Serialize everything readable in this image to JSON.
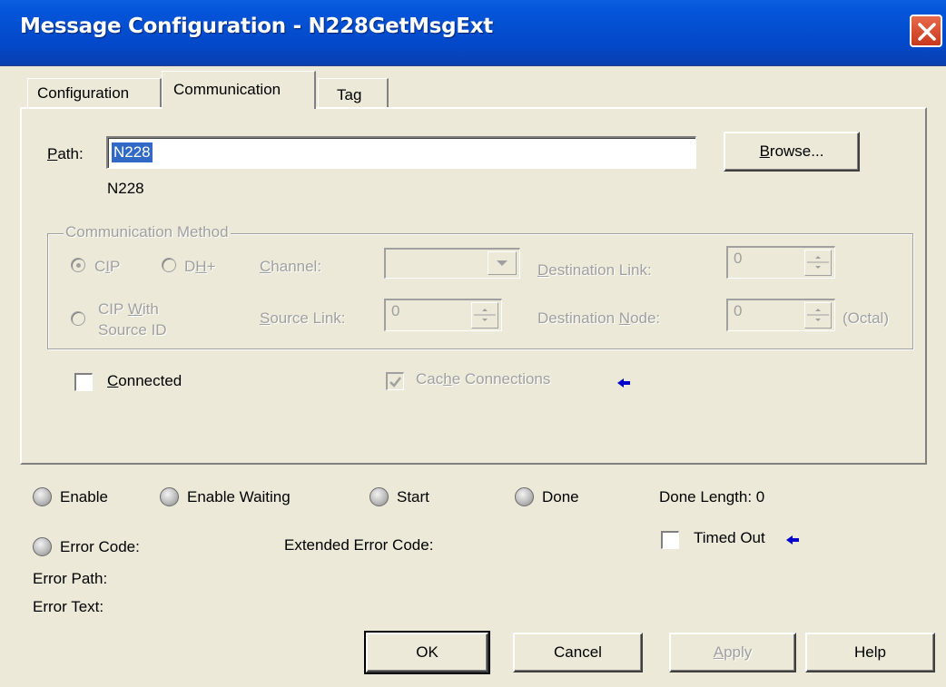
{
  "window": {
    "title": "Message Configuration - N228GetMsgExt"
  },
  "tabs": [
    {
      "label": "Configuration",
      "active": false
    },
    {
      "label": "Communication",
      "active": true
    },
    {
      "label": "Tag",
      "active": false
    }
  ],
  "communication": {
    "path_label": "Path:",
    "path_value": "N228",
    "resolved_path": "N228",
    "browse_label": "Browse...",
    "method_group_label": "Communication Method",
    "cip_label": "CIP",
    "dh_label": "DH+",
    "channel_label": "Channel:",
    "destination_link_label": "Destination Link:",
    "destination_link_value": "0",
    "cip_with_source_id_label_1": "CIP With",
    "cip_with_source_id_label_2": "Source ID",
    "source_link_label": "Source Link:",
    "source_link_value": "0",
    "destination_node_label": "Destination Node:",
    "destination_node_value": "0",
    "octal_label": "(Octal)",
    "connected_label": "Connected",
    "connected_checked": false,
    "cache_connections_label": "Cache Connections",
    "cache_connections_checked": true,
    "arrow_icon": "left-arrow"
  },
  "status": {
    "enable_label": "Enable",
    "enable_waiting_label": "Enable Waiting",
    "start_label": "Start",
    "done_label": "Done",
    "done_length_label": "Done Length: 0",
    "error_code_label": "Error Code:",
    "extended_error_code_label": "Extended Error Code:",
    "timed_out_label": "Timed Out",
    "timed_out_checked": false,
    "error_path_label": "Error Path:",
    "error_text_label": "Error Text:"
  },
  "buttons": {
    "ok": "OK",
    "cancel": "Cancel",
    "apply": "Apply",
    "help": "Help"
  },
  "colors": {
    "titlebar": "#0454d8",
    "dialog_bg": "#ece9d8",
    "selection": "#316ac5",
    "arrow": "#0000cc"
  }
}
